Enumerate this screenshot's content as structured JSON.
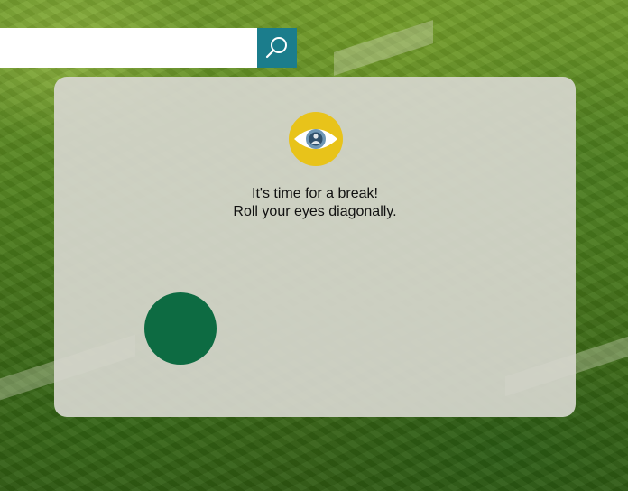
{
  "search": {
    "value": "",
    "placeholder": ""
  },
  "icons": {
    "search_button": "search-icon",
    "badge": "eye-icon"
  },
  "break_card": {
    "line1": "It's time for a break!",
    "line2": "Roll your eyes diagonally."
  },
  "colors": {
    "search_button": "#1b7d8c",
    "badge": "#e8c31a",
    "target_dot": "#0d6b42",
    "panel": "#d6d6ce"
  }
}
